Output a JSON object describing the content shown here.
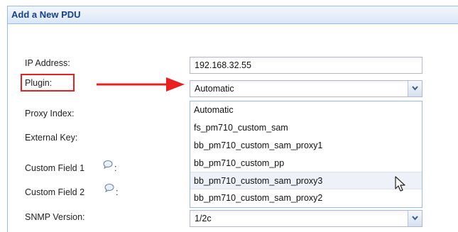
{
  "panel": {
    "title": "Add a New PDU"
  },
  "form": {
    "ip_address_label": "IP Address:",
    "ip_address_value": "192.168.32.55",
    "plugin_label": "Plugin:",
    "plugin_value": "Automatic",
    "proxy_index_label": "Proxy Index:",
    "external_key_label": "External Key:",
    "custom_field_1_label": "Custom Field 1",
    "custom_field_1_suffix": ":",
    "custom_field_2_label": "Custom Field 2",
    "custom_field_2_suffix": ":",
    "snmp_version_label": "SNMP Version:",
    "snmp_version_value": "1/2c"
  },
  "plugin_options": [
    "Automatic",
    "fs_pm710_custom_sam",
    "bb_pm710_custom_sam_proxy1",
    "bb_pm710_custom_pp",
    "bb_pm710_custom_sam_proxy3",
    "bb_pm710_custom_sam_proxy2"
  ],
  "colors": {
    "annotation_red": "#e8201f",
    "header_text": "#15428b",
    "border_blue": "#99bbe8"
  },
  "icons": [
    "help-bubble-icon",
    "chevron-down-icon",
    "mouse-pointer-icon",
    "red-arrow-annotation"
  ]
}
